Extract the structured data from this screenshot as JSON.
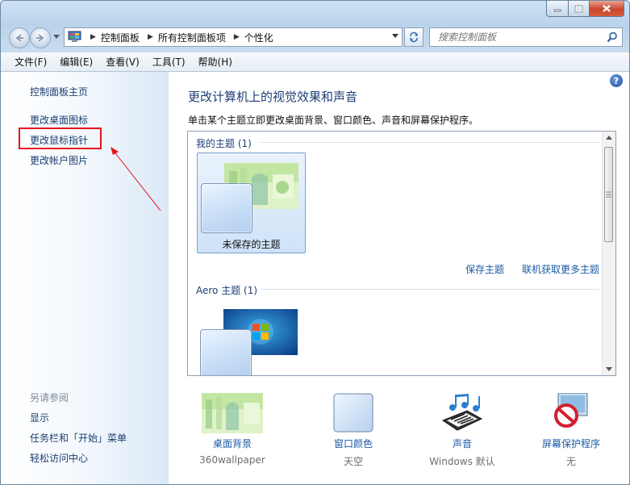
{
  "address": {
    "crumbs": [
      "控制面板",
      "所有控制面板项",
      "个性化"
    ]
  },
  "search": {
    "placeholder": "搜索控制面板"
  },
  "menu": [
    "文件(F)",
    "编辑(E)",
    "查看(V)",
    "工具(T)",
    "帮助(H)"
  ],
  "sidebar": {
    "home": "控制面板主页",
    "links": [
      "更改桌面图标",
      "更改鼠标指针",
      "更改帐户图片"
    ],
    "see_also_label": "另请参阅",
    "see_also": [
      "显示",
      "任务栏和「开始」菜单",
      "轻松访问中心"
    ]
  },
  "main": {
    "title": "更改计算机上的视觉效果和声音",
    "description": "单击某个主题立即更改桌面背景、窗口颜色、声音和屏幕保护程序。",
    "groups": [
      {
        "label": "我的主题 (1)",
        "themes": [
          "未保存的主题"
        ]
      },
      {
        "label": "Aero 主题 (1)",
        "themes": [
          ""
        ]
      }
    ],
    "links": [
      "保存主题",
      "联机获取更多主题"
    ]
  },
  "bottom": [
    {
      "label": "桌面背景",
      "value": "360wallpaper",
      "icon": "wallpaper-thumbnail-icon"
    },
    {
      "label": "窗口颜色",
      "value": "天空",
      "icon": "window-color-icon"
    },
    {
      "label": "声音",
      "value": "Windows 默认",
      "icon": "music-notes-icon"
    },
    {
      "label": "屏幕保护程序",
      "value": "无",
      "icon": "no-screensaver-icon"
    }
  ]
}
